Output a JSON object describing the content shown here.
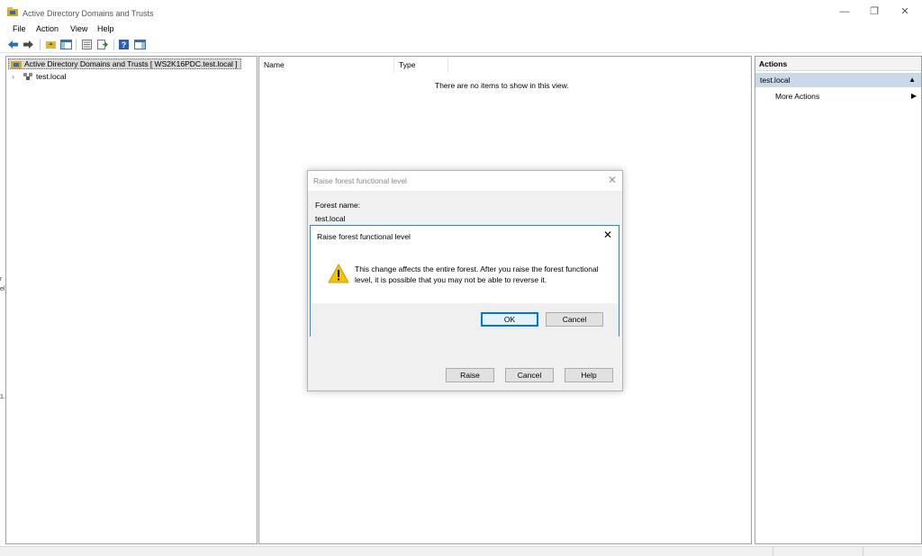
{
  "window": {
    "title": "Active Directory Domains and Trusts",
    "minimize": "—",
    "restore": "❐",
    "close": "✕"
  },
  "menu": [
    "File",
    "Action",
    "View",
    "Help"
  ],
  "toolbar_icons": [
    "back-icon",
    "forward-icon",
    "up-folder-icon",
    "show-hide-console-tree-icon",
    "properties-icon",
    "export-list-icon",
    "help-icon",
    "show-hide-action-pane-icon"
  ],
  "tree": {
    "root_label": "Active Directory Domains and Trusts [ WS2K16PDC.test.local ]",
    "child_arrow": "›",
    "child_label": "test.local"
  },
  "list": {
    "col_name": "Name",
    "col_type": "Type",
    "empty_message": "There are no items to show in this view."
  },
  "actions": {
    "header": "Actions",
    "selected": "test.local",
    "selected_toggle": "▲",
    "more": "More Actions",
    "more_arrow": "▶"
  },
  "outer_dialog": {
    "title": "Raise forest functional level",
    "close": "✕",
    "forest_name_label": "Forest name:",
    "forest_name_value": "test.local",
    "raise": "Raise",
    "cancel": "Cancel",
    "help": "Help"
  },
  "confirm_dialog": {
    "title": "Raise forest functional level",
    "close": "✕",
    "message": "This change affects the entire forest. After you raise the forest functional level, it is possible that you may not be able to reverse it.",
    "ok": "OK",
    "cancel": "Cancel"
  },
  "left_edge_fragments": [
    "r",
    "el",
    "1."
  ],
  "colors": {
    "selection": "#c9d9ea",
    "dialog_border": "#2b8bd8",
    "default_button": "#0078d7",
    "warning": "#f5c400"
  }
}
